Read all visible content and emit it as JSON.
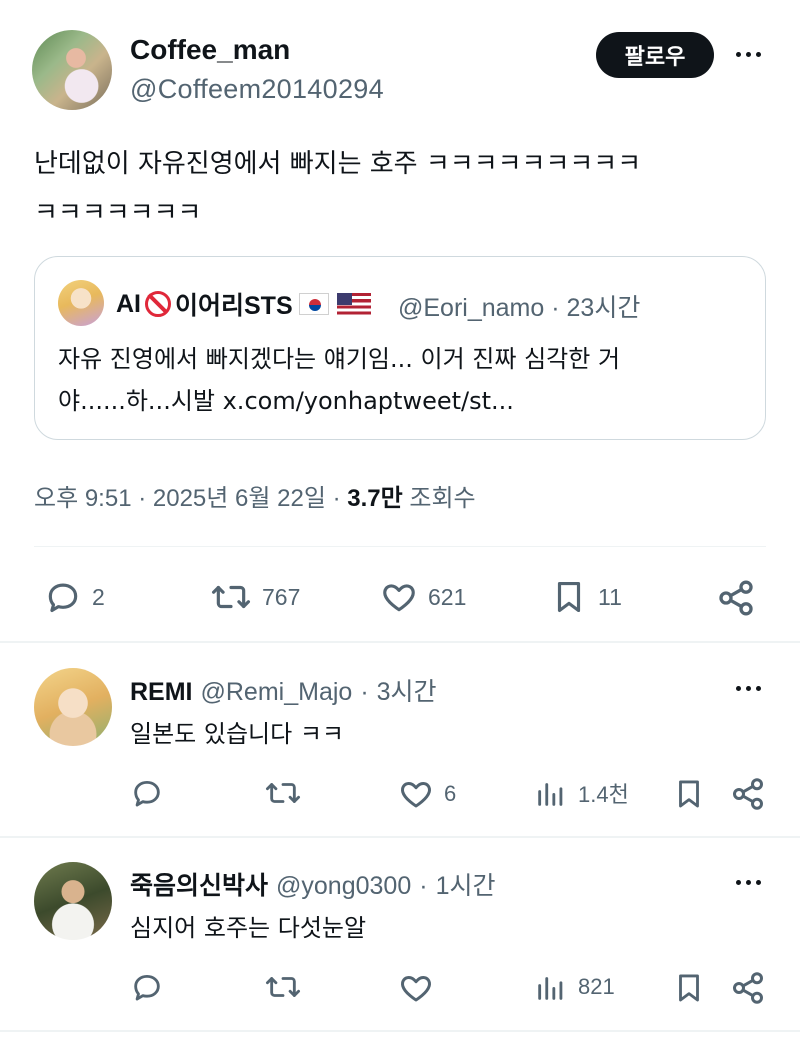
{
  "post": {
    "author_name": "Coffee_man",
    "author_handle": "@Coffeem20140294",
    "follow_label": "팔로우",
    "text_line1": "난데없이 자유진영에서 빠지는 호주 ㅋㅋㅋㅋㅋㅋㅋㅋㅋ",
    "text_line2": "ㅋㅋㅋㅋㅋㅋㅋ",
    "quote": {
      "name_prefix": "AI",
      "name_suffix": "이어리STS",
      "handle": "@Eori_namo",
      "time": "23시간",
      "text_line1": "자유 진영에서 빠지겠다는 얘기임... 이거 진짜 심각한 거",
      "text_line2": "야......하...시발 x.com/yonhaptweet/st..."
    },
    "time": "오후 9:51",
    "date": "2025년 6월 22일",
    "views": "3.7만",
    "views_label": "조회수",
    "stats": {
      "replies": "2",
      "reposts": "767",
      "likes": "621",
      "bookmarks": "11"
    }
  },
  "replies": [
    {
      "name": "REMI",
      "handle": "@Remi_Majo",
      "time": "3시간",
      "text": "일본도 있습니다 ㅋㅋ",
      "likes": "6",
      "views": "1.4천"
    },
    {
      "name": "죽음의신박사",
      "handle": "@yong0300",
      "time": "1시간",
      "text": "심지어 호주는 다섯눈알",
      "likes": "",
      "views": "821"
    }
  ],
  "separator": "·",
  "icons": [
    "more-icon",
    "reply-icon",
    "repost-icon",
    "like-icon",
    "bookmark-icon",
    "share-icon",
    "views-icon",
    "no-entry-icon",
    "flag-kr-icon",
    "flag-us-icon"
  ]
}
